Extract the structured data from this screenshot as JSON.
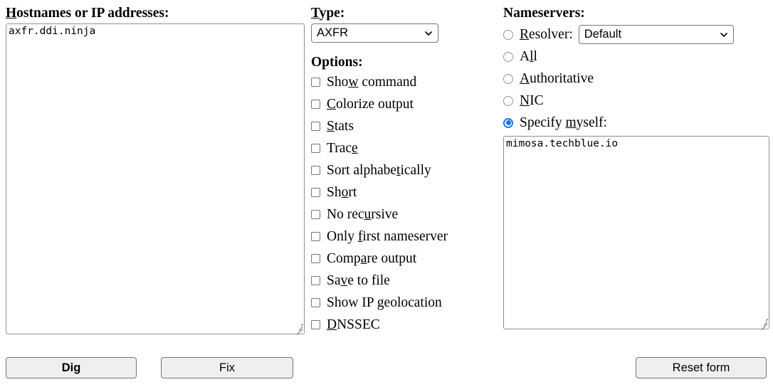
{
  "hostnames": {
    "label_pre": "",
    "label_accesskey": "H",
    "label_post": "ostnames or IP addresses:",
    "value": "axfr.ddi.ninja",
    "placeholder": ""
  },
  "type": {
    "label_accesskey": "T",
    "label_post": "ype:",
    "selected": "AXFR",
    "options": [
      "AXFR"
    ]
  },
  "options": {
    "label": "Options:",
    "items": [
      {
        "pre": "Sho",
        "ak": "w",
        "post": " command",
        "checked": false
      },
      {
        "pre": "",
        "ak": "C",
        "post": "olorize output",
        "checked": false
      },
      {
        "pre": "",
        "ak": "S",
        "post": "tats",
        "checked": false
      },
      {
        "pre": "Trac",
        "ak": "e",
        "post": "",
        "checked": false
      },
      {
        "pre": "Sort alphabe",
        "ak": "t",
        "post": "ically",
        "checked": false
      },
      {
        "pre": "Sh",
        "ak": "o",
        "post": "rt",
        "checked": false
      },
      {
        "pre": "No rec",
        "ak": "u",
        "post": "rsive",
        "checked": false
      },
      {
        "pre": "Only ",
        "ak": "f",
        "post": "irst nameserver",
        "checked": false
      },
      {
        "pre": "Comp",
        "ak": "a",
        "post": "re output",
        "checked": false
      },
      {
        "pre": "Sa",
        "ak": "v",
        "post": "e to file",
        "checked": false
      },
      {
        "pre": "Show IP geolocation",
        "ak": "",
        "post": "",
        "checked": false
      },
      {
        "pre": "",
        "ak": "D",
        "post": "NSSEC",
        "checked": false
      }
    ]
  },
  "nameservers": {
    "label": "Nameservers:",
    "radios": [
      {
        "pre": "",
        "ak": "R",
        "post": "esolver:",
        "selected": false
      },
      {
        "pre": "A",
        "ak": "l",
        "post": "l",
        "selected": false
      },
      {
        "pre": "",
        "ak": "A",
        "post": "uthoritative",
        "selected": false
      },
      {
        "pre": "",
        "ak": "N",
        "post": "IC",
        "selected": false
      },
      {
        "pre": "Specify ",
        "ak": "m",
        "post": "yself:",
        "selected": true
      }
    ],
    "resolver": {
      "selected": "Default",
      "options": [
        "Default"
      ]
    },
    "textarea_value": "mimosa.techblue.io",
    "textarea_placeholder": ""
  },
  "buttons": {
    "dig": "Dig",
    "fix": "Fix",
    "reset": "Reset form"
  },
  "colors": {
    "accent_blue": "#1473e6",
    "control_border": "#767676",
    "button_bg": "#efefef",
    "text": "#000000",
    "page_bg": "#ffffff"
  }
}
